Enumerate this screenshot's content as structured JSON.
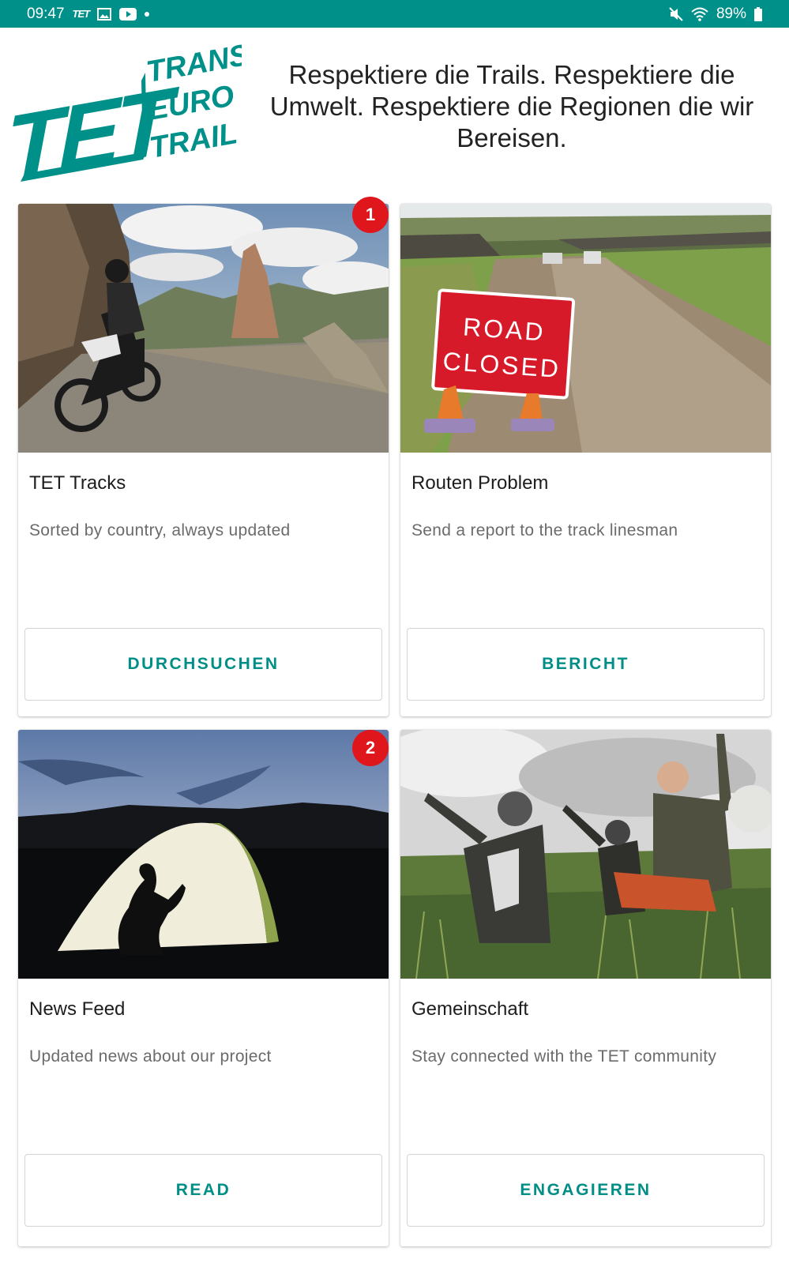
{
  "status_bar": {
    "time": "09:47",
    "app_icon_label": "TET",
    "battery": "89%",
    "icons": [
      "tet-notification-icon",
      "image-icon",
      "youtube-icon",
      "notification-dot-icon",
      "mute-icon",
      "wifi-icon",
      "battery-icon"
    ],
    "color": "#00908a"
  },
  "header": {
    "logo_text": {
      "big": "TET",
      "line1": "TRANS",
      "line2": "EURO",
      "line3": "TRAIL"
    },
    "tagline": "Respektiere die Trails. Respektiere die Umwelt. Respektiere die Regionen die wir Bereisen."
  },
  "accent": "#008e87",
  "badge_color": "#e0161d",
  "cards": [
    {
      "title": "TET Tracks",
      "description": "Sorted by country, always updated",
      "button": "DURCHSUCHEN",
      "badge": "1",
      "image": "motorcycle-mountain-trail"
    },
    {
      "title": "Routen Problem",
      "description": "Send a report to the track linesman",
      "button": "BERICHT",
      "badge": "",
      "image": "road-closed-sign",
      "sign_line1": "ROAD",
      "sign_line2": "CLOSED"
    },
    {
      "title": "News Feed",
      "description": "Updated news about our project",
      "button": "READ",
      "badge": "2",
      "image": "tent-at-dusk"
    },
    {
      "title": "Gemeinschaft",
      "description": "Stay connected with the TET community",
      "button": "ENGAGIEREN",
      "badge": "",
      "image": "riders-in-field"
    }
  ]
}
